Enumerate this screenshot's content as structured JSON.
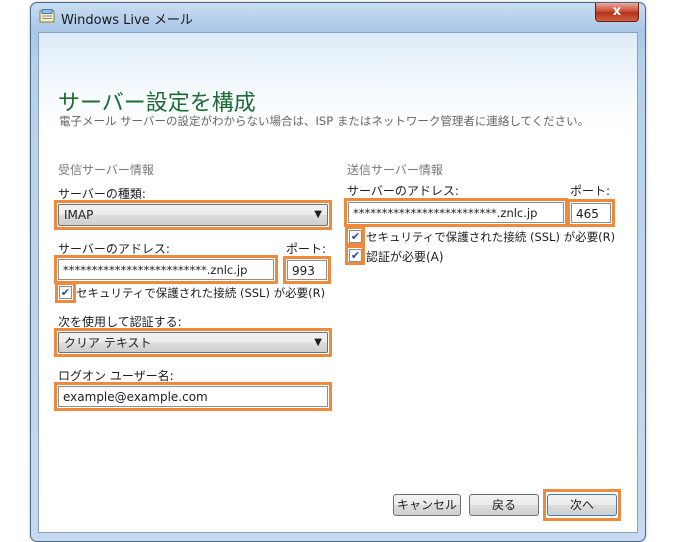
{
  "window": {
    "title": "Windows Live メール",
    "close_glyph": "x"
  },
  "page": {
    "heading": "サーバー設定を構成",
    "subheading": "電子メール サーバーの設定がわからない場合は、ISP またはネットワーク管理者に連絡してください。"
  },
  "incoming": {
    "section_label": "受信サーバー情報",
    "server_type_label": "サーバーの種類:",
    "server_type_value": "IMAP",
    "address_label": "サーバーのアドレス:",
    "address_value": "*************************.znlc.jp",
    "port_label": "ポート:",
    "port_value": "993",
    "ssl_label": "セキュリティで保護された接続 (SSL) が必要(R)",
    "ssl_checked": true,
    "auth_label": "次を使用して認証する:",
    "auth_value": "クリア テキスト",
    "logon_label": "ログオン ユーザー名:",
    "logon_value": "example@example.com"
  },
  "outgoing": {
    "section_label": "送信サーバー情報",
    "address_label": "サーバーのアドレス:",
    "address_value": "*************************.znlc.jp",
    "port_label": "ポート:",
    "port_value": "465",
    "ssl_label": "セキュリティで保護された接続 (SSL) が必要(R)",
    "ssl_checked": true,
    "auth_required_label": "認証が必要(A)",
    "auth_required_checked": true
  },
  "buttons": {
    "cancel": "キャンセル",
    "back": "戻る",
    "next": "次へ"
  },
  "icons": {
    "checkmark": "✔",
    "dropdown": "▼",
    "app": "mail-app-icon"
  },
  "colors": {
    "highlight": "#ee8a3e",
    "heading": "#1f6a35"
  }
}
